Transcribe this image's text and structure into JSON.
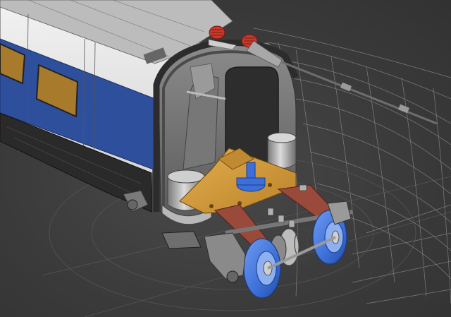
{
  "scene": {
    "background_color": "#3c3c3c",
    "colors": {
      "body_white": "#e8e8e8",
      "stripe_blue": "#2e4f9c",
      "window_amber": "#a77a2c",
      "bogie_orange": "#d19a3a",
      "wheel_blue": "#3c6fd8",
      "spring_red": "#c8382b",
      "metal_gray": "#9a9a9a",
      "wireframe_line": "#8a8a8a"
    },
    "parts": [
      "car-body",
      "blue-stripe",
      "side-window",
      "cab-nose-shell",
      "pantograph-insulator",
      "air-spring",
      "bogie-bolster",
      "center-pivot",
      "wheelset",
      "axle-box",
      "traction-motor",
      "wireframe-surface"
    ]
  }
}
